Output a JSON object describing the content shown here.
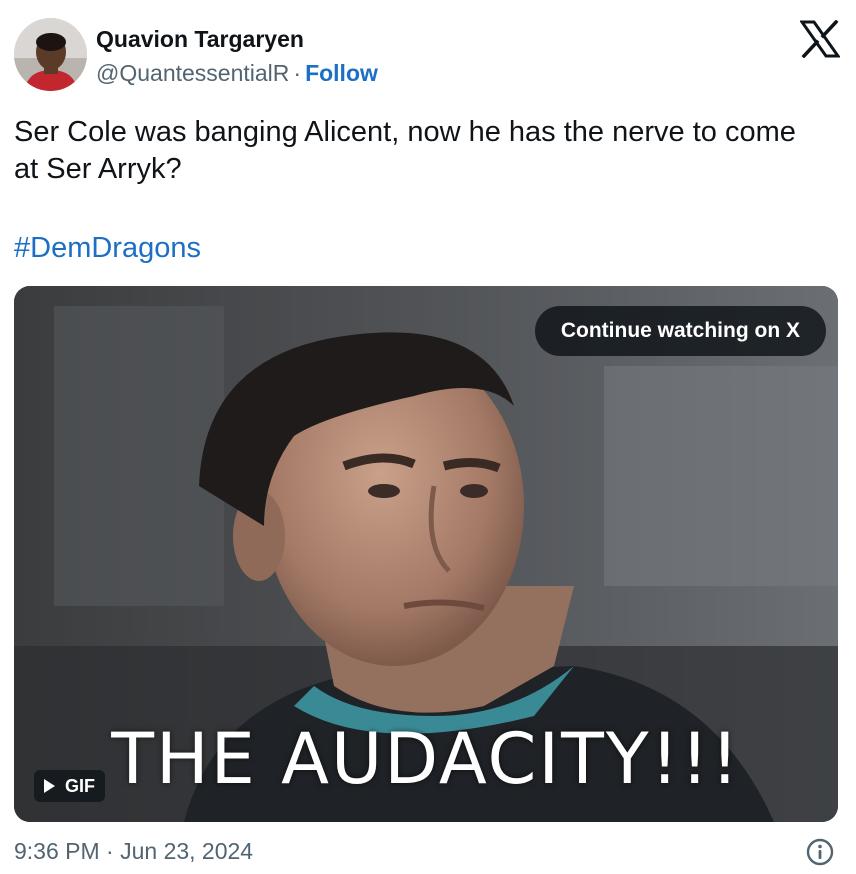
{
  "author": {
    "name": "Quavion Targaryen",
    "handle": "@QuantessentialR",
    "separator": "·",
    "follow_label": "Follow"
  },
  "brand": {
    "icon": "x-logo-icon"
  },
  "tweet": {
    "text": "Ser Cole was banging Alicent, now he has the nerve to come at Ser Arryk?",
    "hashtag": "#DemDragons"
  },
  "media": {
    "continue_label": "Continue watching on X",
    "caption": "THE AUDACITY!!!",
    "gif_label": "GIF",
    "play_icon": "play-icon"
  },
  "footer": {
    "timestamp": "9:36 PM · Jun 23, 2024",
    "info_icon": "info-icon"
  },
  "colors": {
    "accent": "#1d6fc4",
    "secondary_text": "#536471",
    "primary_text": "#0f1419"
  }
}
